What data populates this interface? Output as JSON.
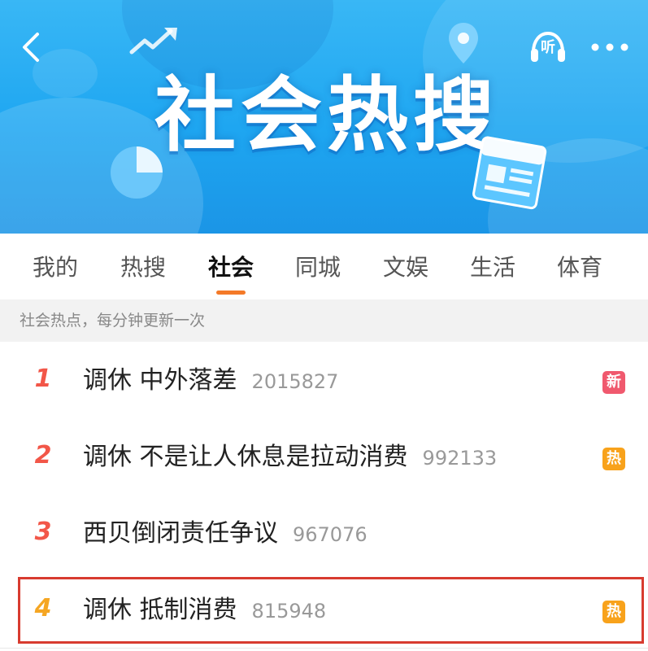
{
  "header": {
    "title": "社会热搜",
    "listen_label": "听",
    "bg_color": "#1ea6f1"
  },
  "icons": {
    "back": "chevron-left-icon",
    "listen": "headphones-icon",
    "more": "more-dots-icon",
    "banner_news": "news-newspaper-icon"
  },
  "tabs": [
    {
      "label": "我的",
      "active": false
    },
    {
      "label": "热搜",
      "active": false
    },
    {
      "label": "社会",
      "active": true
    },
    {
      "label": "同城",
      "active": false
    },
    {
      "label": "文娱",
      "active": false
    },
    {
      "label": "生活",
      "active": false
    },
    {
      "label": "体育",
      "active": false
    }
  ],
  "subheader": {
    "text": "社会热点，每分钟更新一次"
  },
  "items": [
    {
      "rank": "1",
      "title": "调休 中外落差",
      "count": "2015827",
      "badge": "新",
      "rank_color": "#f25648",
      "badge_color": "#f0596e"
    },
    {
      "rank": "2",
      "title": "调休 不是让人休息是拉动消费",
      "count": "992133",
      "badge": "热",
      "rank_color": "#f25648",
      "badge_color": "#f8a21b"
    },
    {
      "rank": "3",
      "title": "西贝倒闭责任争议",
      "count": "967076",
      "badge": "",
      "rank_color": "#f25648",
      "badge_color": ""
    },
    {
      "rank": "4",
      "title": "调休 抵制消费",
      "count": "815948",
      "badge": "热",
      "rank_color": "#f5a623",
      "badge_color": "#f8a21b"
    }
  ],
  "colors": {
    "accent": "#f47a28",
    "highlight_border": "#d83b2f"
  }
}
